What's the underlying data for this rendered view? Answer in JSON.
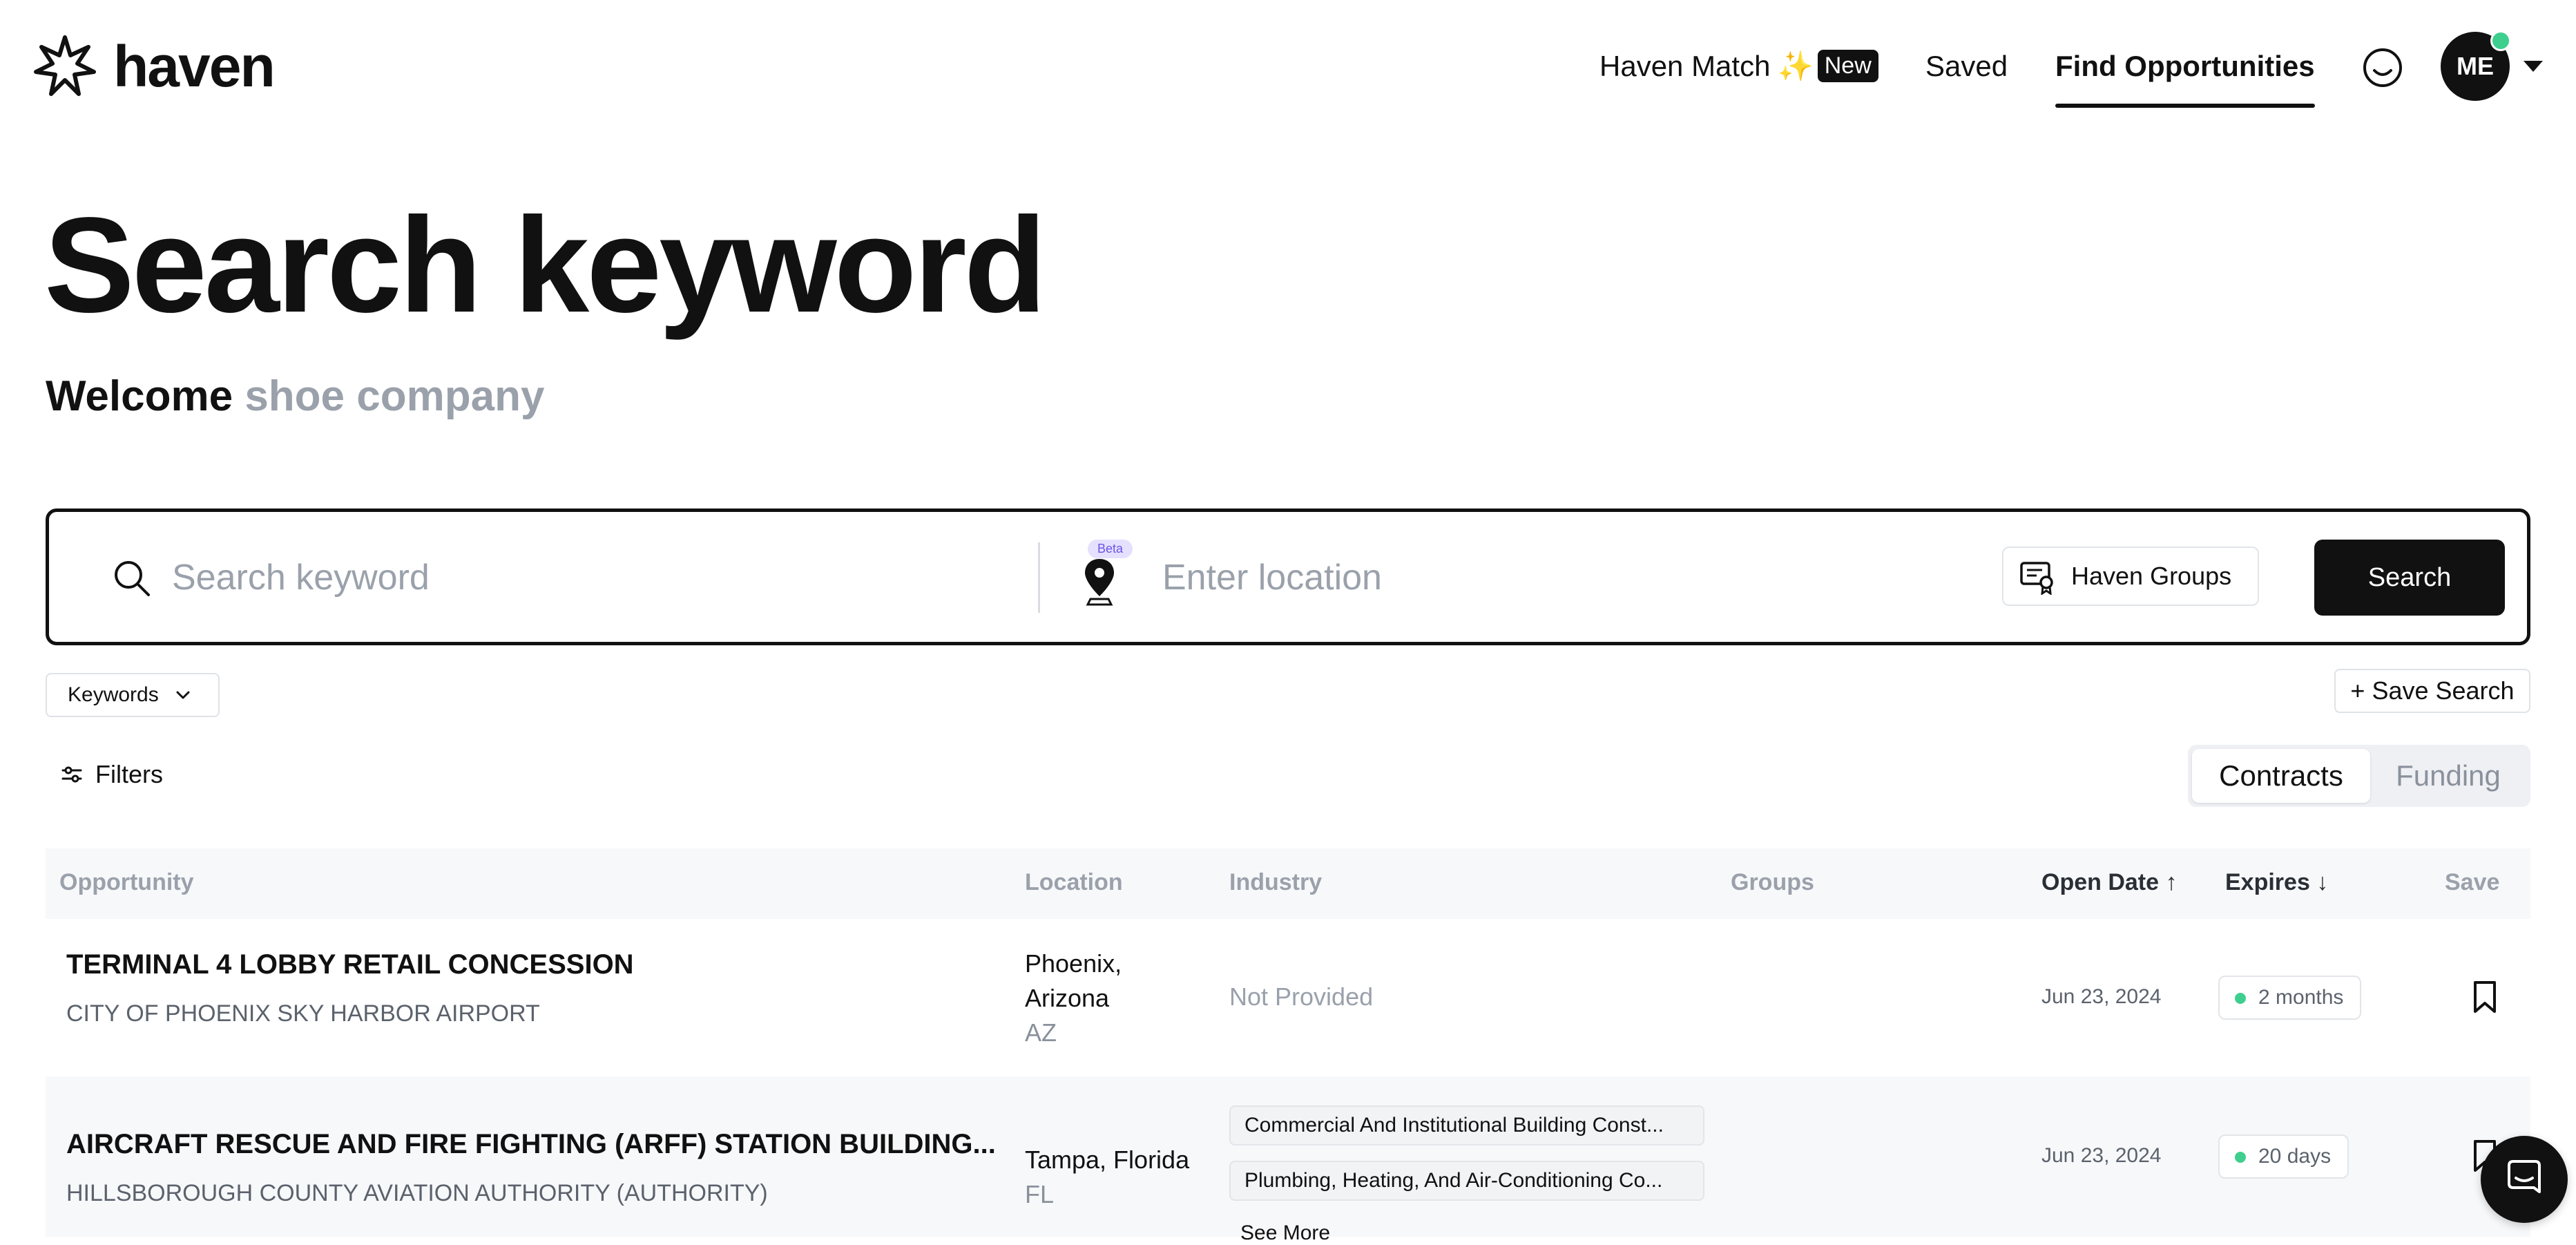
{
  "brand": {
    "name": "haven"
  },
  "nav": {
    "items": [
      {
        "label": "Haven Match",
        "badge": "New",
        "icon": "sparkle-icon"
      },
      {
        "label": "Saved"
      },
      {
        "label": "Find Opportunities",
        "active": true
      }
    ],
    "avatar_initials": "ME",
    "status_color": "#3ecf8e"
  },
  "hero": {
    "title": "Search keyword",
    "welcome_prefix": "Welcome",
    "company": "shoe company"
  },
  "search": {
    "keyword_placeholder": "Search keyword",
    "location_placeholder": "Enter location",
    "beta_label": "Beta",
    "groups_label": "Haven Groups",
    "search_label": "Search"
  },
  "toolbar": {
    "keywords_label": "Keywords",
    "save_search_label": "+ Save Search",
    "filters_label": "Filters",
    "tabs": [
      {
        "label": "Contracts",
        "active": true
      },
      {
        "label": "Funding",
        "active": false
      }
    ]
  },
  "table": {
    "columns": {
      "opportunity": "Opportunity",
      "location": "Location",
      "industry": "Industry",
      "groups": "Groups",
      "open_date": "Open Date ↑",
      "expires": "Expires ↓",
      "save": "Save"
    },
    "rows": [
      {
        "title": "TERMINAL 4 LOBBY RETAIL CONCESSION",
        "agency": "CITY OF PHOENIX SKY HARBOR AIRPORT",
        "location_city": "Phoenix, Arizona",
        "location_state": "AZ",
        "industry": "Not Provided",
        "open_date": "Jun 23, 2024",
        "expires": "2 months"
      },
      {
        "title": "AIRCRAFT RESCUE AND FIRE FIGHTING (ARFF) STATION BUILDING...",
        "agency": "HILLSBOROUGH COUNTY AVIATION AUTHORITY (AUTHORITY)",
        "location_city": "Tampa, Florida",
        "location_state": "FL",
        "industry_tags": [
          "Commercial And Institutional Building Const...",
          "Plumbing, Heating, And Air-Conditioning Co..."
        ],
        "see_more": "See More",
        "open_date": "Jun 23, 2024",
        "expires": "20 days"
      }
    ]
  },
  "colors": {
    "primary": "#111111",
    "muted": "#9aa1ab",
    "success": "#3ecf8e",
    "beta": "#6c54e8"
  }
}
